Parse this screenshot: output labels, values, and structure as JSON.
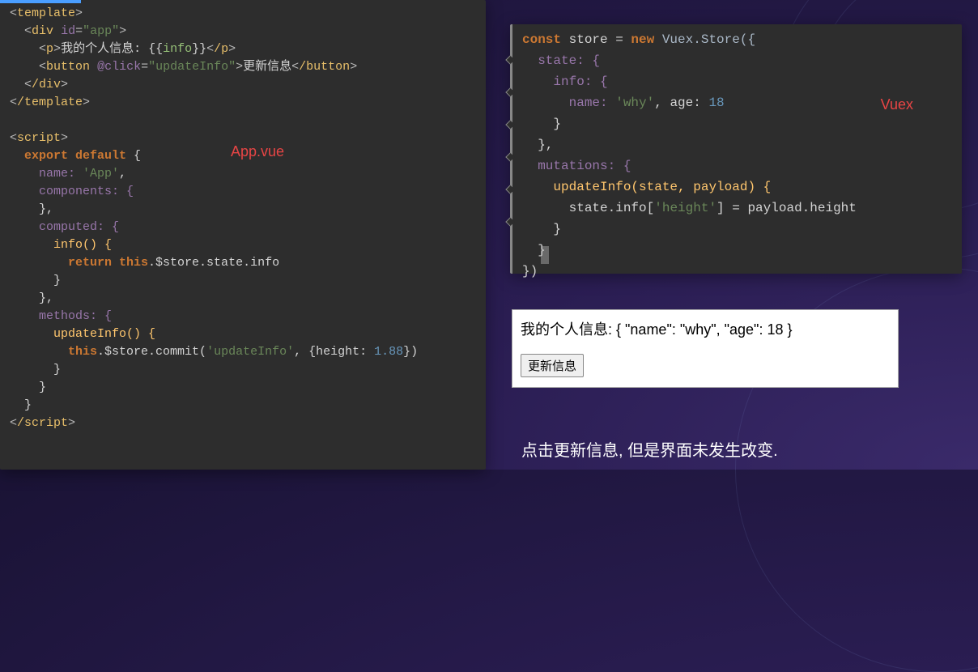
{
  "labels": {
    "app_vue": "App.vue",
    "vuex": "Vuex"
  },
  "left_code": {
    "l1": {
      "tag": "template"
    },
    "l2": {
      "tag": "div",
      "attr_name": "id",
      "attr_val": "\"app\""
    },
    "l3": {
      "tag_open": "p",
      "text_a": "我的个人信息: {{",
      "var": "info",
      "text_b": "}}",
      "tag_close": "/p"
    },
    "l4": {
      "tag": "button",
      "attr_name": "@click",
      "attr_val": "\"updateInfo\"",
      "text": "更新信息",
      "tag_close": "/button"
    },
    "l5": {
      "tag": "/div"
    },
    "l6": {
      "tag": "/template"
    },
    "l7": {
      "tag": "script"
    },
    "l8a": "export default",
    "l8b": " {",
    "l9a": "name: ",
    "l9b": "'App'",
    "l9c": ",",
    "l10": "components: {",
    "l11": "},",
    "l12": "computed: {",
    "l13": "info() {",
    "l14a": "return ",
    "l14b": "this",
    "l14c": ".$store.state.info",
    "l15": "}",
    "l16": "},",
    "l17": "methods: {",
    "l18": "updateInfo() {",
    "l19a": "this",
    "l19b": ".$store.commit(",
    "l19c": "'updateInfo'",
    "l19d": ", {height: ",
    "l19e": "1.88",
    "l19f": "})",
    "l20": "}",
    "l21": "}",
    "l22": "}",
    "l23": {
      "tag": "/script"
    }
  },
  "right_code": {
    "l1a": "const ",
    "l1b": "store = ",
    "l1c": "new ",
    "l1d": "Vuex.Store({",
    "l2": "state: {",
    "l3": "info: {",
    "l4a": "name: ",
    "l4b": "'why'",
    "l4c": ", age: ",
    "l4d": "18",
    "l5": "}",
    "l6": "},",
    "l7": "mutations: {",
    "l8": "updateInfo(state, payload) {",
    "l9a": "state.info[",
    "l9b": "'height'",
    "l9c": "] = payload.height",
    "l10": "}",
    "l11": "}",
    "l12": "})"
  },
  "output": {
    "prefix": "我的个人信息: ",
    "json": "{ \"name\": \"why\", \"age\": 18 }",
    "button": "更新信息"
  },
  "caption": "点击更新信息, 但是界面未发生改变."
}
